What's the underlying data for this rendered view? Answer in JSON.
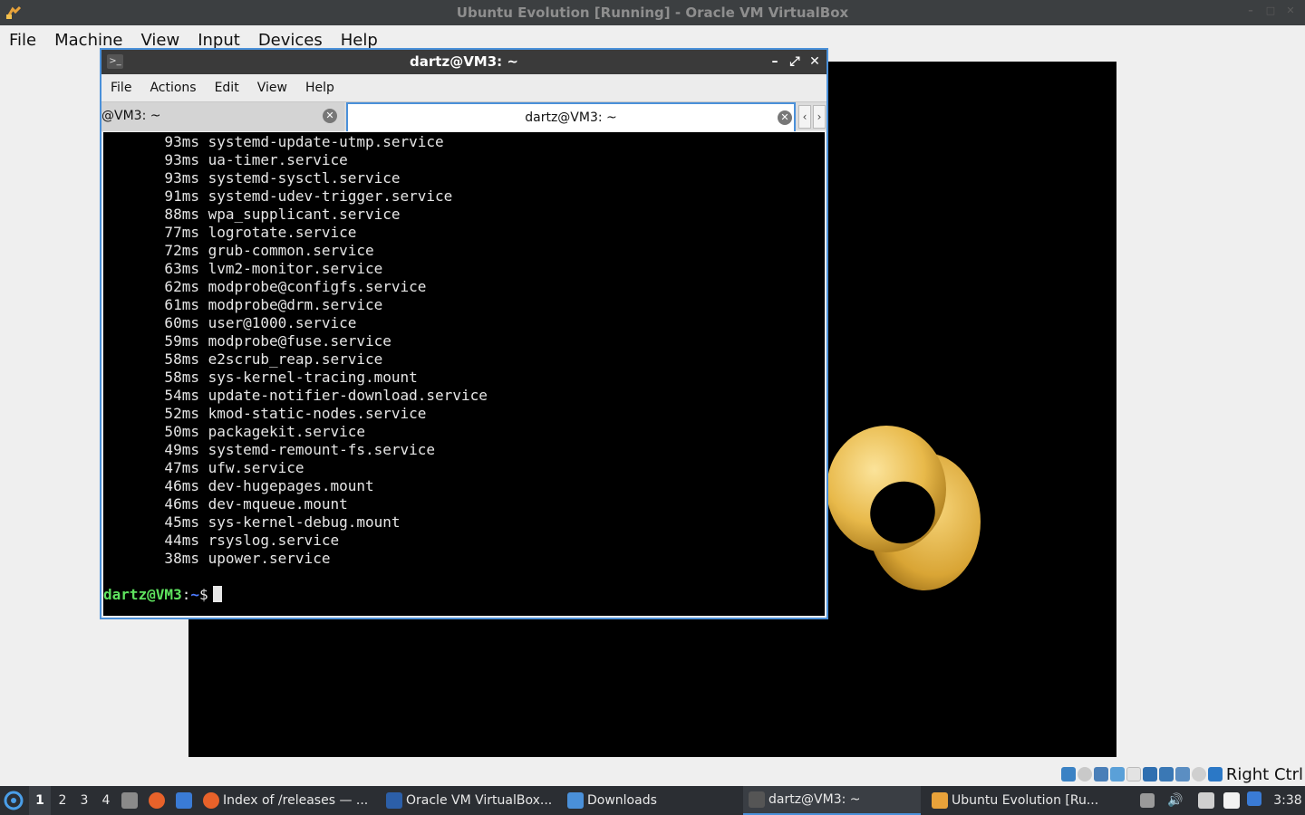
{
  "host": {
    "title": "Ubuntu Evolution [Running] - Oracle VM VirtualBox",
    "menu": [
      "File",
      "Machine",
      "View",
      "Input",
      "Devices",
      "Help"
    ],
    "host_key": "Right Ctrl"
  },
  "terminal": {
    "title": "dartz@VM3: ~",
    "menu": [
      "File",
      "Actions",
      "Edit",
      "View",
      "Help"
    ],
    "tabs": [
      "@VM3: ~",
      "dartz@VM3: ~"
    ],
    "lines": [
      "       93ms systemd-update-utmp.service",
      "       93ms ua-timer.service",
      "       93ms systemd-sysctl.service",
      "       91ms systemd-udev-trigger.service",
      "       88ms wpa_supplicant.service",
      "       77ms logrotate.service",
      "       72ms grub-common.service",
      "       63ms lvm2-monitor.service",
      "       62ms modprobe@configfs.service",
      "       61ms modprobe@drm.service",
      "       60ms user@1000.service",
      "       59ms modprobe@fuse.service",
      "       58ms e2scrub_reap.service",
      "       58ms sys-kernel-tracing.mount",
      "       54ms update-notifier-download.service",
      "       52ms kmod-static-nodes.service",
      "       50ms packagekit.service",
      "       49ms systemd-remount-fs.service",
      "       47ms ufw.service",
      "       46ms dev-hugepages.mount",
      "       46ms dev-mqueue.mount",
      "       45ms sys-kernel-debug.mount",
      "       44ms rsyslog.service",
      "       38ms upower.service"
    ],
    "prompt_user": "dartz@VM3",
    "prompt_sep": ":",
    "prompt_path": "~",
    "prompt_symbol": "$"
  },
  "taskbar": {
    "workspaces": [
      "1",
      "2",
      "3",
      "4"
    ],
    "tasks": [
      "Index of /releases — ...",
      "Oracle VM VirtualBox...",
      "Downloads",
      "dartz@VM3: ~",
      "Ubuntu Evolution [Ru..."
    ],
    "clock": "3:38"
  },
  "colors": {
    "prompt_user": "#5fe35f",
    "prompt_path": "#4d7bff",
    "window_focus": "#4a90d9",
    "torus": "#e8b94a"
  }
}
